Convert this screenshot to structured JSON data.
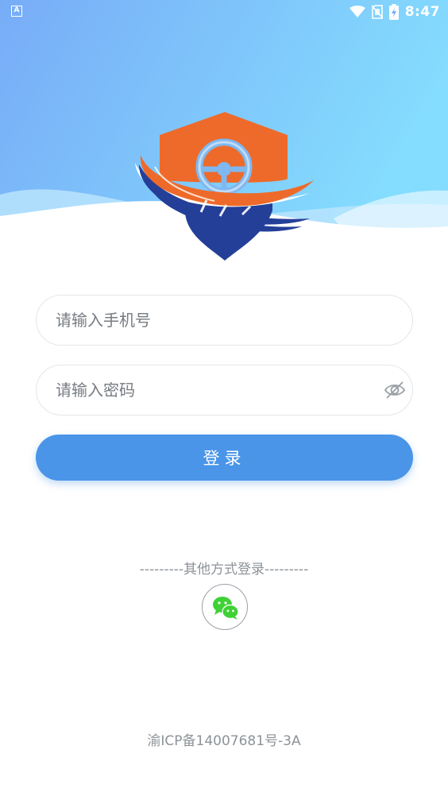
{
  "status_bar": {
    "left_icon": "A",
    "icons": [
      "wifi-icon",
      "no-sim-icon",
      "battery-charging-icon"
    ],
    "time": "8:47"
  },
  "colors": {
    "hero_gradient_start": "#78acf7",
    "hero_gradient_end": "#84dcfe",
    "logo_orange": "#ee6a2a",
    "logo_navy": "#243f98",
    "primary_button": "#4a95e8",
    "wechat_green": "#3ed236"
  },
  "login_form": {
    "phone_placeholder": "请输入手机号",
    "password_placeholder": "请输入密码",
    "login_label": "登录"
  },
  "other_login": {
    "label": "---------其他方式登录---------",
    "wechat_icon": "wechat-icon"
  },
  "footer": {
    "icp": "渝ICP备14007681号-3A"
  }
}
